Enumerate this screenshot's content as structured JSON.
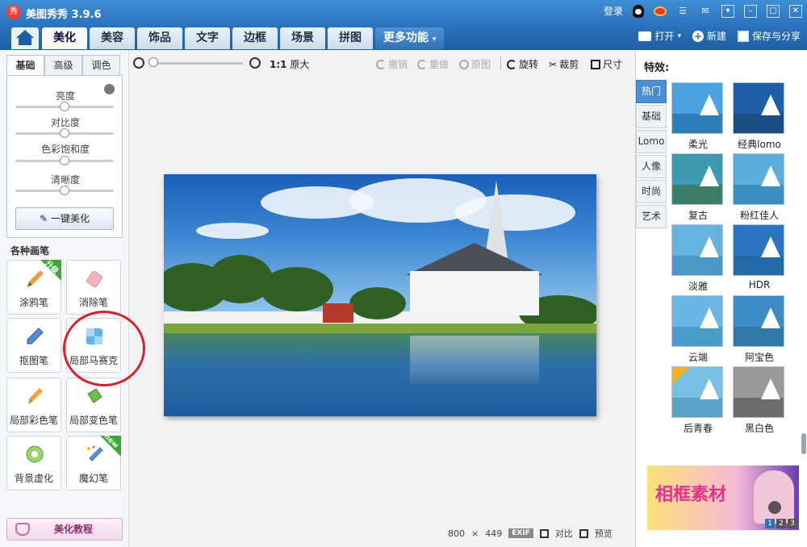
{
  "app": {
    "logo_text": "秀",
    "title": "美图秀秀 3.9.6",
    "login": "登录"
  },
  "tabs": [
    "美化",
    "美容",
    "饰品",
    "文字",
    "边框",
    "场景",
    "拼图",
    "更多功能"
  ],
  "top_actions": {
    "open": "打开",
    "new": "新建",
    "save_share": "保存与分享"
  },
  "left_panel": {
    "subtabs": [
      "基础",
      "高级",
      "调色"
    ],
    "sliders": [
      {
        "label": "亮度",
        "value": 0.5
      },
      {
        "label": "对比度",
        "value": 0.5
      },
      {
        "label": "色彩饱和度",
        "value": 0.5
      },
      {
        "label": "清晰度",
        "value": 0.5
      }
    ],
    "one_key_button": "一键美化",
    "brushes_title": "各种画笔",
    "tools": [
      {
        "label": "涂鸦笔",
        "badge": "升级"
      },
      {
        "label": "消除笔"
      },
      {
        "label": "抠图笔"
      },
      {
        "label": "局部马赛克"
      },
      {
        "label": "局部彩色笔"
      },
      {
        "label": "局部变色笔"
      },
      {
        "label": "背景虚化"
      },
      {
        "label": "魔幻笔",
        "badge": "new"
      }
    ],
    "tutorial_button": "美化教程"
  },
  "toolbar": {
    "orig_ratio": "1:1",
    "orig_label": "原大",
    "undo": "撤销",
    "redo": "重做",
    "original": "原图",
    "rotate": "旋转",
    "crop": "裁剪",
    "size": "尺寸"
  },
  "status": {
    "width": "800",
    "times": "×",
    "height": "449",
    "exif": "EXIF",
    "compare": "对比",
    "preview": "预览"
  },
  "right_panel": {
    "title": "特效:",
    "categories": [
      "热门",
      "基础",
      "Lomo",
      "人像",
      "时尚",
      "艺术"
    ],
    "effects": [
      {
        "name": "柔光",
        "sky": "#4aa3e0",
        "water": "#2e7fb8"
      },
      {
        "name": "经典lomo",
        "sky": "#1d5ea8",
        "water": "#1a4f85"
      },
      {
        "name": "复古",
        "sky": "#3e9ab0",
        "water": "#3a7e6a"
      },
      {
        "name": "粉红佳人",
        "sky": "#5aaede",
        "water": "#3a8fc0"
      },
      {
        "name": "淡雅",
        "sky": "#67b3e0",
        "water": "#4a98c8"
      },
      {
        "name": "HDR",
        "sky": "#2b74c2",
        "water": "#236aa8"
      },
      {
        "name": "云端",
        "sky": "#6ab7e6",
        "water": "#4b9ccb"
      },
      {
        "name": "阿宝色",
        "sky": "#3d8bc6",
        "water": "#2f78aa"
      },
      {
        "name": "后青春",
        "sky": "#78bfe6",
        "water": "#5aa2c8",
        "badge": "会员"
      },
      {
        "name": "黑白色",
        "sky": "#9a9a9a",
        "water": "#6d6d6d"
      }
    ],
    "ad": {
      "text": "相框素材",
      "pages": [
        "1",
        "2",
        "3"
      ]
    }
  },
  "colors": {
    "title_bar": "#2c73bd",
    "accent": "#4a8fd6",
    "annotation_circle": "#d4232b"
  }
}
